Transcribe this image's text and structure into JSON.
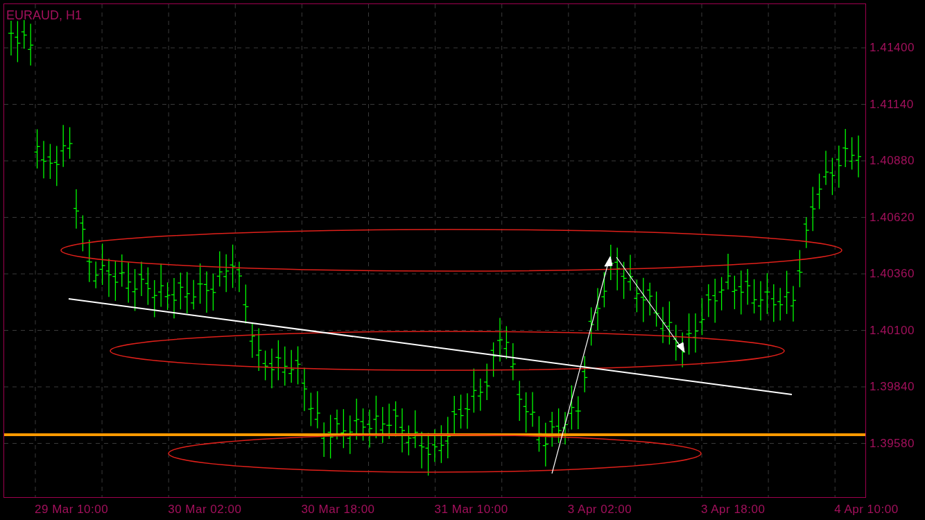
{
  "chart": {
    "title": "EURAUD, H1",
    "price_labels": [
      "1.41400",
      "1.41140",
      "1.40880",
      "1.40620",
      "1.40360",
      "1.40100",
      "1.39840",
      "1.39580"
    ],
    "time_labels": [
      "29 Mar 10:00",
      "30 Mar 02:00",
      "30 Mar 18:00",
      "31 Mar 10:00",
      "3 Apr 02:00",
      "3 Apr 18:00",
      "4 Apr 10:00"
    ]
  }
}
